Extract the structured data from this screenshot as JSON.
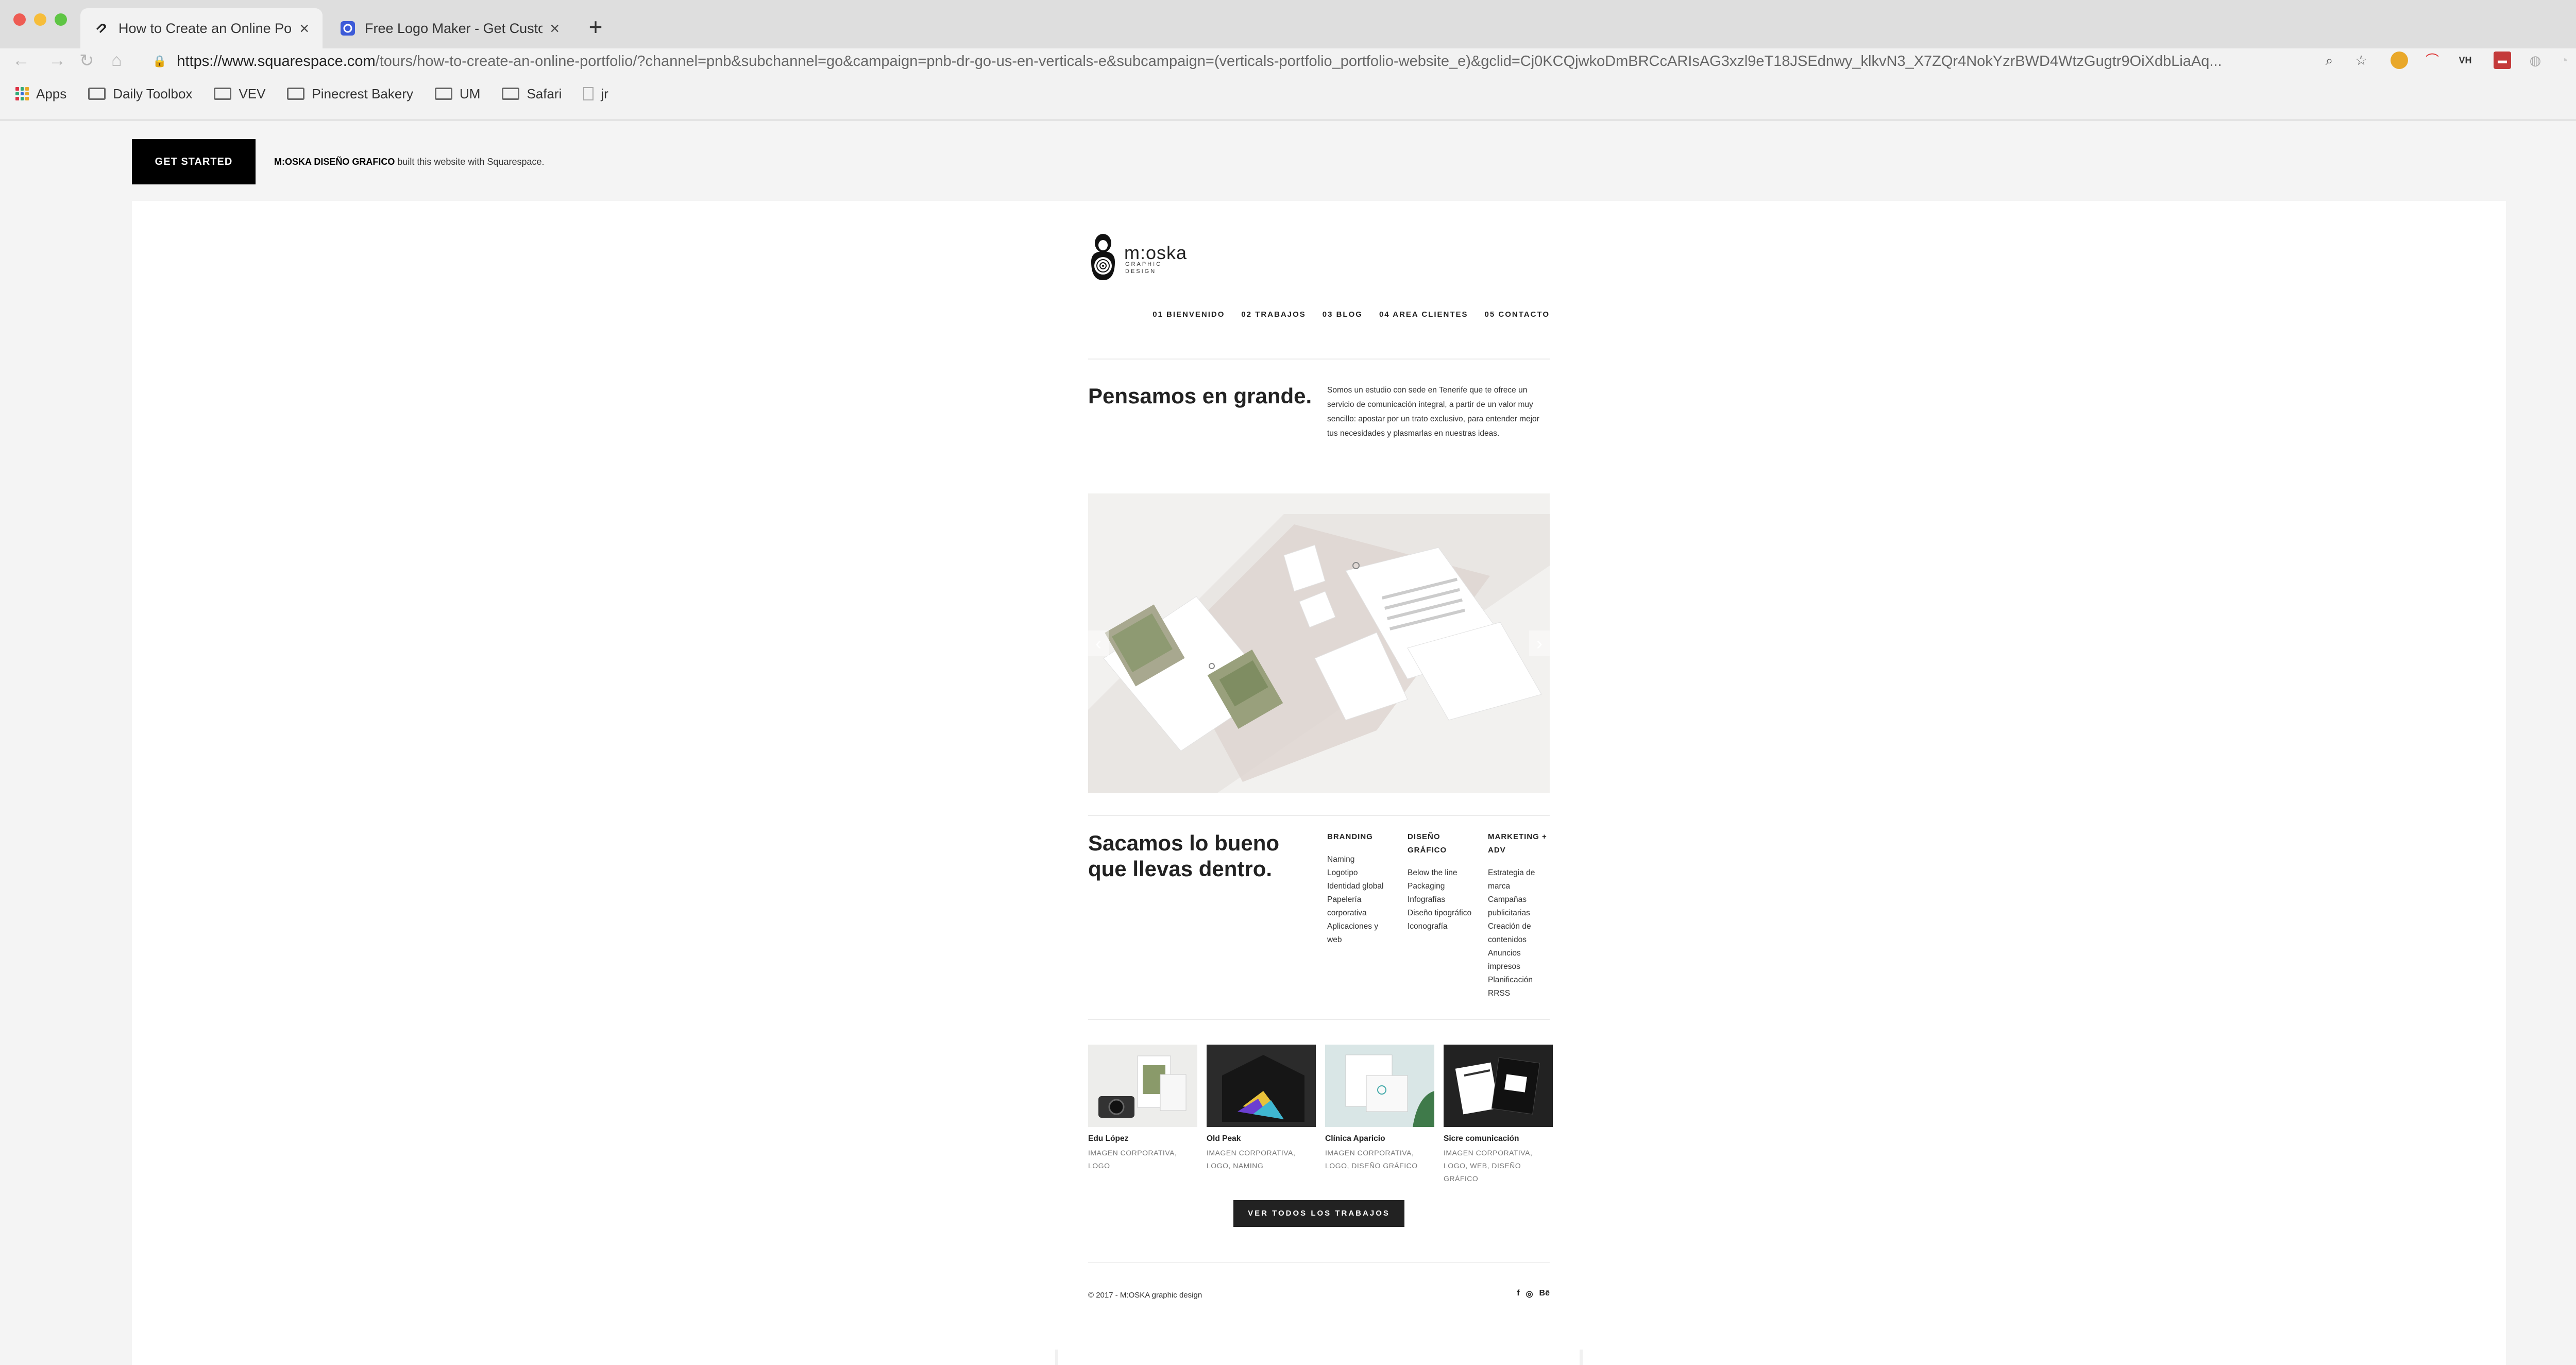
{
  "browser": {
    "tabs": [
      {
        "title": "How to Create an Online Portfolio",
        "active": true
      },
      {
        "title": "Free Logo Maker - Get Custom",
        "active": false
      }
    ],
    "new_tab": "+",
    "url_host": "https://www.squarespace.com",
    "url_path": "/tours/how-to-create-an-online-portfolio/?channel=pnb&subchannel=go&campaign=pnb-dr-go-us-en-verticals-e&subcampaign=(verticals-portfolio_portfolio-website_e)&gclid=Cj0KCQjwkoDmBRCcARIsAG3xzl9eT18JSEdnwy_klkvN3_X7ZQr4NokYzrBWD4WtzGugtr9OiXdbLiaAq...",
    "bookmarks": [
      "Apps",
      "Daily Toolbox",
      "VEV",
      "Pinecrest Bakery",
      "UM",
      "Safari",
      "jr"
    ]
  },
  "overlay": {
    "cta_label": "GET STARTED",
    "builder_name": "M:OSKA DISEÑO GRAFICO",
    "builder_suffix": " built this website with Squarespace.",
    "close": "×"
  },
  "site": {
    "logo_text": "m:oska",
    "logo_sub": "GRAPHIC DESIGN",
    "nav": [
      "01 BIENVENIDO",
      "02 TRABAJOS",
      "03 BLOG",
      "04 AREA CLIENTES",
      "05 CONTACTO"
    ],
    "hero_heading": "Pensamos en grande.",
    "hero_text": "Somos un estudio con sede en Tenerife que te ofrece un servicio de comunicación integral, a partir de un valor muy sencillo: apostar por un trato exclusivo, para entender mejor tus necesidades y plasmarlas en nuestras ideas.",
    "services_heading": "Sacamos lo bueno que llevas dentro.",
    "services": [
      {
        "title": "BRANDING",
        "items": [
          "Naming",
          "Logotipo",
          "Identidad global",
          "Papelería corporativa",
          "Aplicaciones y web"
        ]
      },
      {
        "title": "DISEÑO GRÁFICO",
        "items": [
          "Below the line",
          "Packaging",
          "Infografías",
          "Diseño tipográfico",
          "Iconografía"
        ]
      },
      {
        "title": "MARKETING + ADV",
        "items": [
          "Estrategia de marca",
          "Campañas publicitarias",
          "Creación de contenidos",
          "Anuncios impresos",
          "Planificación RRSS"
        ]
      }
    ],
    "projects": [
      {
        "name": "Edu López",
        "tags": "IMAGEN CORPORATIVA, LOGO"
      },
      {
        "name": "Old Peak",
        "tags": "IMAGEN CORPORATIVA, LOGO, NAMING"
      },
      {
        "name": "Clínica Aparicio",
        "tags": "IMAGEN CORPORATIVA, LOGO, DISEÑO GRÁFICO"
      },
      {
        "name": "Sicre comunicación",
        "tags": "IMAGEN CORPORATIVA, LOGO, WEB, DISEÑO GRÁFICO"
      }
    ],
    "cta": "VER TODOS LOS TRABAJOS",
    "copyright": "© 2017 - M:OSKA graphic design",
    "social": [
      "f",
      "◎",
      "Bē"
    ]
  }
}
